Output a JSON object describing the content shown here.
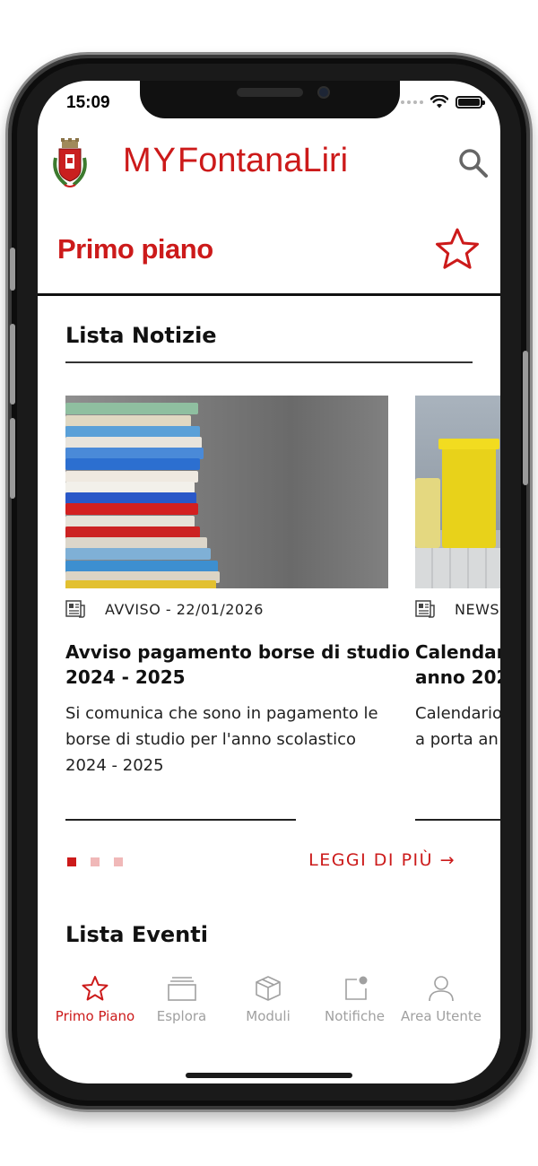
{
  "status_bar": {
    "time": "15:09"
  },
  "header": {
    "brand_my": "MY",
    "brand_name": "FontanaLiri",
    "search_icon": "search-icon",
    "crest_icon": "municipal-crest-icon"
  },
  "section": {
    "title": "Primo piano",
    "favorite_icon": "star-outline-icon"
  },
  "news": {
    "title": "Lista Notizie",
    "cards": [
      {
        "image": "stack-of-books-photo",
        "meta": "AVVISO - 22/01/2026",
        "title_line1": "Avviso pagamento borse di studio",
        "title_line2": "2024 - 2025",
        "desc_line1": "Si comunica che sono in pagamento le",
        "desc_line2": "borse di studio per l'anno scolastico",
        "desc_line3": "2024 - 2025"
      },
      {
        "image": "waste-bins-photo",
        "meta": "NEWS",
        "title_line1": "Calendari",
        "title_line2": "anno 202",
        "desc_line1": "Calendario",
        "desc_line2": "a porta an",
        "desc_line3": ""
      }
    ],
    "pagination": {
      "total": 3,
      "active": 1
    },
    "more_link": "LEGGI DI PIÙ →"
  },
  "events": {
    "title": "Lista Eventi"
  },
  "tabbar": {
    "items": [
      {
        "label": "Primo Piano",
        "icon": "star-icon",
        "active": true
      },
      {
        "label": "Esplora",
        "icon": "stack-icon",
        "active": false
      },
      {
        "label": "Moduli",
        "icon": "box-icon",
        "active": false
      },
      {
        "label": "Notifiche",
        "icon": "notification-icon",
        "active": false
      },
      {
        "label": "Area Utente",
        "icon": "user-icon",
        "active": false
      }
    ]
  },
  "colors": {
    "accent": "#cc1a1a",
    "text": "#111111",
    "inactive": "#a0a0a0"
  }
}
